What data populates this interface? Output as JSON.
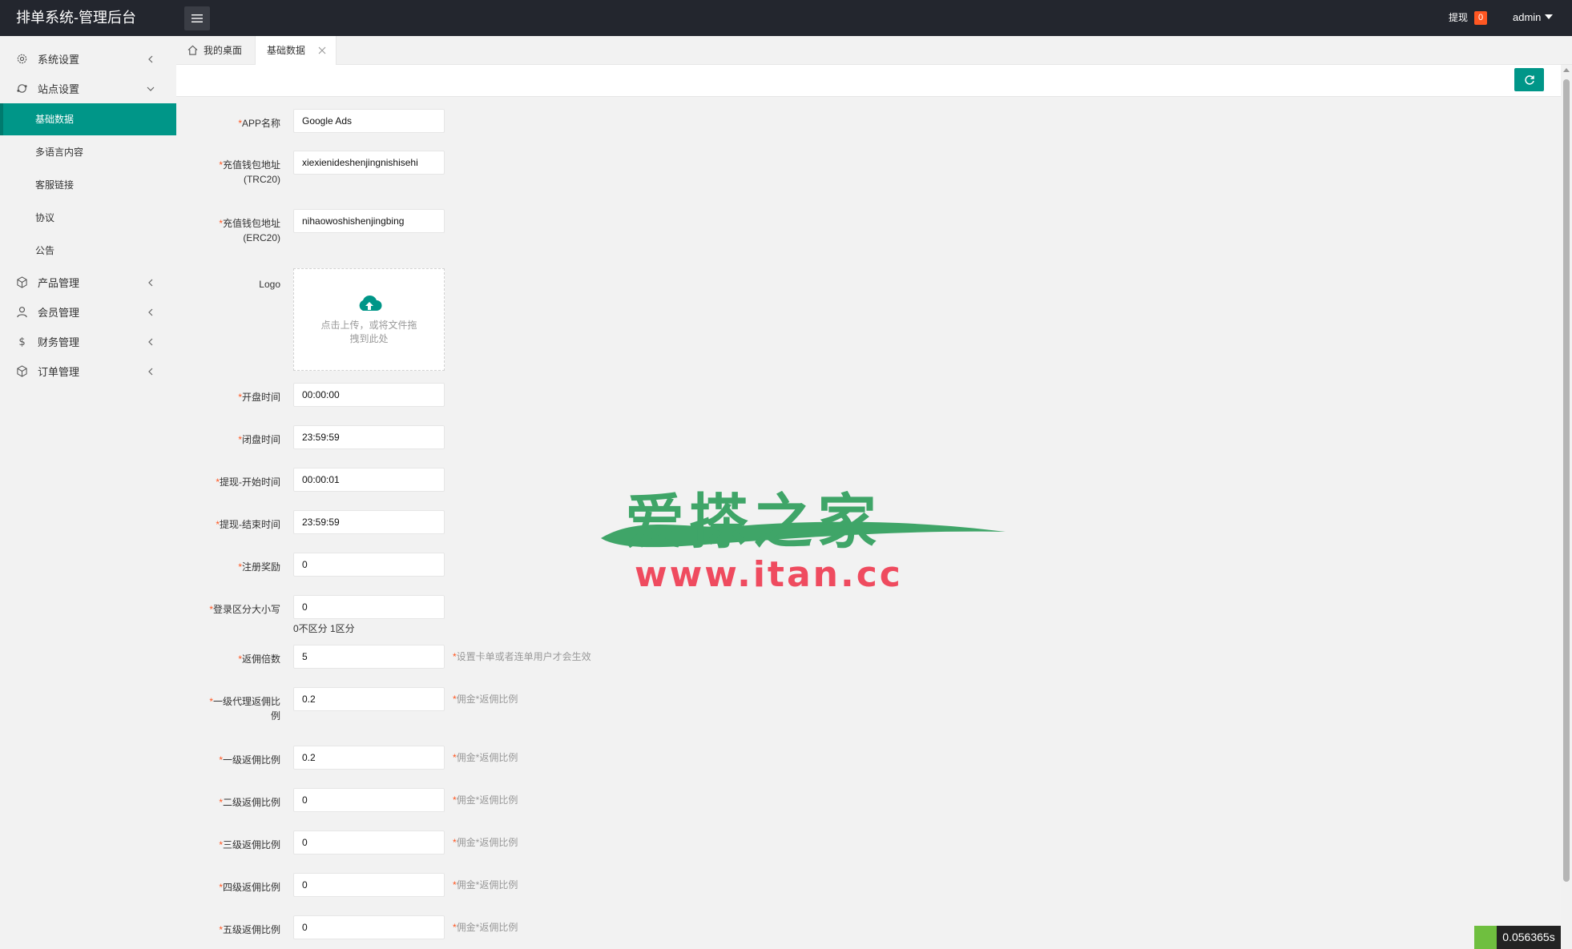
{
  "header": {
    "title": "排单系统-管理后台",
    "withdraw_label": "提现",
    "withdraw_count": "0",
    "user": "admin"
  },
  "sidebar": {
    "items": [
      {
        "label": "系统设置",
        "icon": "gear-icon"
      },
      {
        "label": "站点设置",
        "icon": "site-icon"
      },
      {
        "label": "产品管理",
        "icon": "cube-icon"
      },
      {
        "label": "会员管理",
        "icon": "user-icon"
      },
      {
        "label": "财务管理",
        "icon": "dollar-icon"
      },
      {
        "label": "订单管理",
        "icon": "cube-icon"
      }
    ],
    "sub_items": [
      "基础数据",
      "多语言内容",
      "客服链接",
      "协议",
      "公告"
    ]
  },
  "tabs": {
    "home": "我的桌面",
    "current": "基础数据"
  },
  "form": {
    "app_name": {
      "label": "APP名称",
      "value": "Google Ads"
    },
    "trc20": {
      "label1": "充值钱包地址",
      "label2": "(TRC20)",
      "value": "xiexienideshenjingnishisehi"
    },
    "erc20": {
      "label1": "充值钱包地址",
      "label2": "(ERC20)",
      "value": "nihaowoshishenjingbing"
    },
    "logo": {
      "label": "Logo",
      "upload_text": "点击上传，或将文件拖拽到此处"
    },
    "open_time": {
      "label": "开盘时间",
      "value": "00:00:00"
    },
    "close_time": {
      "label": "闭盘时间",
      "value": "23:59:59"
    },
    "withdraw_start": {
      "label": "提现-开始时间",
      "value": "00:00:01"
    },
    "withdraw_end": {
      "label": "提现-结束时间",
      "value": "23:59:59"
    },
    "register_bonus": {
      "label": "注册奖励",
      "value": "0"
    },
    "login_case": {
      "label": "登录区分大小写",
      "value": "0",
      "note": "0不区分 1区分"
    },
    "rebate_multiple": {
      "label": "返佣倍数",
      "value": "5",
      "hint": "设置卡单或者连单用户才会生效"
    },
    "agent1_rebate": {
      "label1": "一级代理返佣比",
      "label2": "例",
      "value": "0.2",
      "hint": "佣金*返佣比例"
    },
    "rebate1": {
      "label": "一级返佣比例",
      "value": "0.2",
      "hint": "佣金*返佣比例"
    },
    "rebate2": {
      "label": "二级返佣比例",
      "value": "0",
      "hint": "佣金*返佣比例"
    },
    "rebate3": {
      "label": "三级返佣比例",
      "value": "0",
      "hint": "佣金*返佣比例"
    },
    "rebate4": {
      "label": "四级返佣比例",
      "value": "0",
      "hint": "佣金*返佣比例"
    },
    "rebate5": {
      "label": "五级返佣比例",
      "value": "0",
      "hint": "佣金*返佣比例"
    }
  },
  "watermark": {
    "text": "爱搽之家",
    "url": "www.itan.cc"
  },
  "timer": "0.056365s",
  "colors": {
    "primary": "#009688",
    "header_bg": "#23262e",
    "required": "#ff5722",
    "badge": "#ff5722"
  }
}
